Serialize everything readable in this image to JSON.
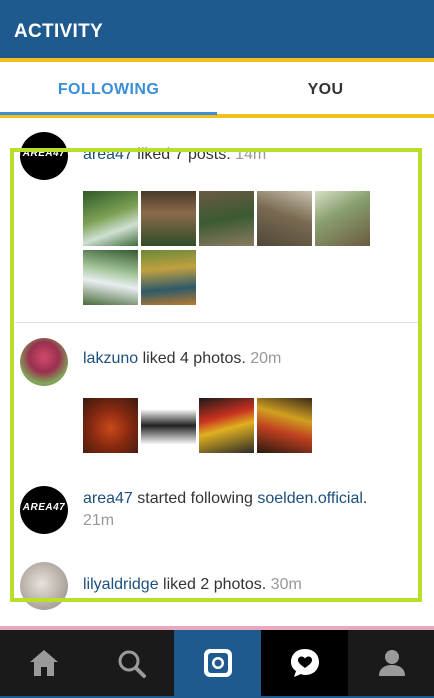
{
  "header": {
    "title": "ACTIVITY"
  },
  "tabs": [
    {
      "label": "FOLLOWING",
      "active": true
    },
    {
      "label": "YOU",
      "active": false
    }
  ],
  "feed": [
    {
      "avatar_text": "AREA47",
      "user": "area47",
      "action": " liked 7 posts. ",
      "time": "14m",
      "thumbnails": 7
    },
    {
      "user": "lakzuno",
      "action": " liked 4 photos. ",
      "time": "20m",
      "thumbnails": 4
    },
    {
      "avatar_text": "AREA47",
      "user": "area47",
      "action": " started following ",
      "target": "soelden.official",
      "suffix": ".",
      "time": "21m"
    },
    {
      "user": "lilyaldridge",
      "action": " liked 2 photos. ",
      "time": "30m"
    }
  ],
  "bottom_nav": [
    {
      "icon": "home-icon"
    },
    {
      "icon": "search-icon"
    },
    {
      "icon": "camera-icon",
      "active": true
    },
    {
      "icon": "heart-speech-icon",
      "active": true
    },
    {
      "icon": "profile-icon"
    }
  ],
  "colors": {
    "primary": "#1f5a8f",
    "accent_yellow": "#f2c01e",
    "tab_active": "#3a8fd6",
    "link": "#1d4f7c",
    "highlight": "#b8e02a"
  }
}
